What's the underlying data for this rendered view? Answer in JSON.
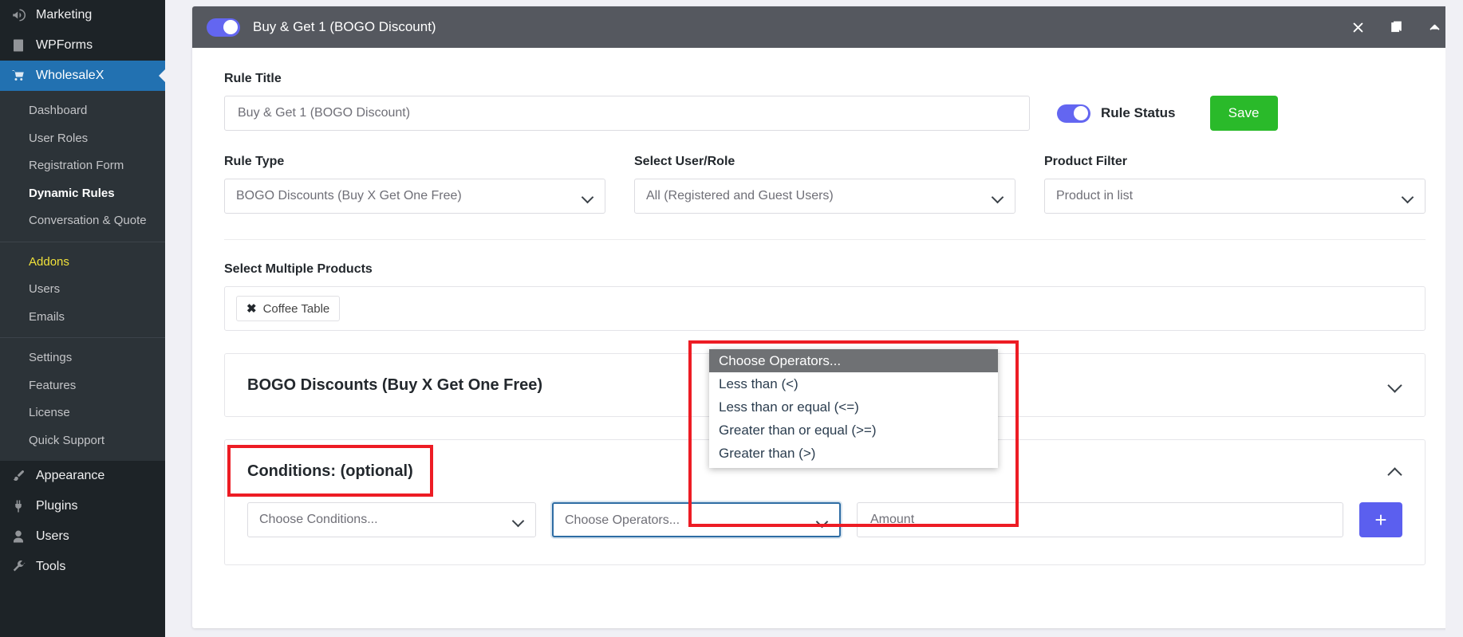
{
  "sidebar": {
    "top_items": [
      {
        "label": "Marketing",
        "icon": "megaphone-icon",
        "active": false
      },
      {
        "label": "WPForms",
        "icon": "forms-icon",
        "active": false
      },
      {
        "label": "WholesaleX",
        "icon": "cart-icon",
        "active": true
      }
    ],
    "submenu_group_1": [
      {
        "label": "Dashboard",
        "current": false
      },
      {
        "label": "User Roles",
        "current": false
      },
      {
        "label": "Registration Form",
        "current": false
      },
      {
        "label": "Dynamic Rules",
        "current": true
      },
      {
        "label": "Conversation & Quote",
        "current": false
      }
    ],
    "submenu_group_2": [
      {
        "label": "Addons",
        "highlight": true
      },
      {
        "label": "Users",
        "highlight": false
      },
      {
        "label": "Emails",
        "highlight": false
      }
    ],
    "submenu_group_3": [
      {
        "label": "Settings"
      },
      {
        "label": "Features"
      },
      {
        "label": "License"
      },
      {
        "label": "Quick Support"
      }
    ],
    "bottom_items": [
      {
        "label": "Appearance",
        "icon": "paintbrush-icon"
      },
      {
        "label": "Plugins",
        "icon": "plug-icon"
      },
      {
        "label": "Users",
        "icon": "user-icon"
      },
      {
        "label": "Tools",
        "icon": "wrench-icon"
      }
    ]
  },
  "rule_header": {
    "title": "Buy & Get 1 (BOGO Discount)",
    "toggle_on": true,
    "actions": [
      {
        "name": "close-icon",
        "glyph": "×"
      },
      {
        "name": "duplicate-icon",
        "glyph": "❐"
      },
      {
        "name": "collapse-icon",
        "glyph": "⌃"
      }
    ]
  },
  "form": {
    "rule_title_label": "Rule Title",
    "rule_title_value": "Buy & Get 1 (BOGO Discount)",
    "rule_status_label": "Rule Status",
    "rule_status_on": true,
    "save_label": "Save",
    "rule_type_label": "Rule Type",
    "rule_type_value": "BOGO Discounts (Buy X Get One Free)",
    "user_role_label": "Select User/Role",
    "user_role_value": "All (Registered and Guest Users)",
    "product_filter_label": "Product Filter",
    "product_filter_value": "Product in list",
    "products_label": "Select Multiple Products",
    "product_chips": [
      {
        "remove_glyph": "✖",
        "label": "Coffee Table"
      }
    ]
  },
  "bogo_panel": {
    "title": "BOGO Discounts (Buy X Get One Free)",
    "expanded": false
  },
  "conditions_panel": {
    "title": "Conditions: (optional)",
    "expanded": true,
    "choose_conditions_value": "Choose Conditions...",
    "choose_operators_value": "Choose Operators...",
    "amount_placeholder": "Amount",
    "add_button_label": "+"
  },
  "operators_dropdown": {
    "open": true,
    "options": [
      {
        "label": "Choose Operators...",
        "selected": true
      },
      {
        "label": "Less than (<)",
        "selected": false
      },
      {
        "label": "Less than or equal (<=)",
        "selected": false
      },
      {
        "label": "Greater than or equal (>=)",
        "selected": false
      },
      {
        "label": "Greater than (>)",
        "selected": false
      }
    ]
  },
  "annotations": {
    "highlight_color": "#ed1c24",
    "boxes": [
      "conditions-title",
      "operators-dropdown"
    ]
  },
  "colors": {
    "accent_purple": "#6366f1",
    "save_green": "#2aba2a",
    "sidebar_bg": "#1d2327",
    "sidebar_active": "#2271b1",
    "header_gray": "#55585f",
    "dropdown_selected": "#6f7174",
    "annotation_red": "#ed1c24"
  }
}
